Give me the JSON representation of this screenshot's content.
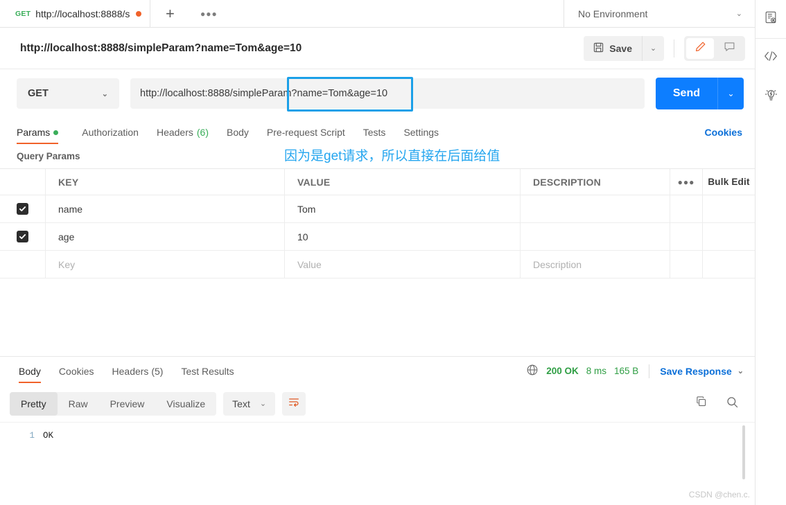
{
  "tabstrip": {
    "tab": {
      "method": "GET",
      "name": "http://localhost:8888/s",
      "unsaved_dot": "●"
    },
    "new_tab_label": "+",
    "more_label": "●●●",
    "environment": {
      "value": "No Environment",
      "caret": "⌄"
    },
    "env_icon": "environment-quick-look-icon"
  },
  "request": {
    "title": "http://localhost:8888/simpleParam?name=Tom&age=10",
    "save_label": "Save",
    "save_caret": "⌄",
    "method": "GET",
    "method_caret": "⌄",
    "url_base": "http://localhost:8888/simpleParam",
    "url_query": "?name=Tom&age=10",
    "send_label": "Send",
    "send_caret": "⌄"
  },
  "request_tabs": [
    {
      "label": "Params",
      "badge": "dot",
      "active": true
    },
    {
      "label": "Authorization",
      "badge": "",
      "active": false
    },
    {
      "label": "Headers",
      "badge": "(6)",
      "active": false
    },
    {
      "label": "Body",
      "badge": "",
      "active": false
    },
    {
      "label": "Pre-request Script",
      "badge": "",
      "active": false
    },
    {
      "label": "Tests",
      "badge": "",
      "active": false
    },
    {
      "label": "Settings",
      "badge": "",
      "active": false
    }
  ],
  "cookies_link": "Cookies",
  "query_params": {
    "section_title": "Query Params",
    "columns": {
      "key": "KEY",
      "value": "VALUE",
      "description": "DESCRIPTION",
      "more": "●●●",
      "bulk_edit": "Bulk Edit"
    },
    "rows": [
      {
        "checked": true,
        "key": "name",
        "value": "Tom",
        "description": ""
      },
      {
        "checked": true,
        "key": "age",
        "value": "10",
        "description": ""
      }
    ],
    "placeholder_row": {
      "key": "Key",
      "value": "Value",
      "description": "Description"
    }
  },
  "response": {
    "tabs": [
      {
        "label": "Body",
        "active": true
      },
      {
        "label": "Cookies",
        "active": false
      },
      {
        "label": "Headers (5)",
        "active": false
      },
      {
        "label": "Test Results",
        "active": false
      }
    ],
    "status": "200 OK",
    "time": "8 ms",
    "size": "165 B",
    "save_response": "Save Response",
    "save_response_caret": "⌄",
    "globe_icon": "globe-icon"
  },
  "viewer": {
    "modes": [
      {
        "label": "Pretty",
        "active": true
      },
      {
        "label": "Raw",
        "active": false
      },
      {
        "label": "Preview",
        "active": false
      },
      {
        "label": "Visualize",
        "active": false
      }
    ],
    "format": "Text",
    "format_caret": "⌄",
    "wrap_icon": "wrap-lines-icon",
    "copy_icon": "copy-icon",
    "search_icon": "search-icon"
  },
  "code": {
    "line_number": "1",
    "body": "OK"
  },
  "annotations": {
    "note": "因为是get请求，所以直接在后面给值"
  },
  "watermark": "CSDN @chen.c.",
  "colors": {
    "accent_orange": "#f0622a",
    "send_blue": "#0d7eff",
    "link_blue": "#0b6fd8",
    "success_green": "#2f9e44",
    "annotation_blue": "#25a6ef"
  }
}
